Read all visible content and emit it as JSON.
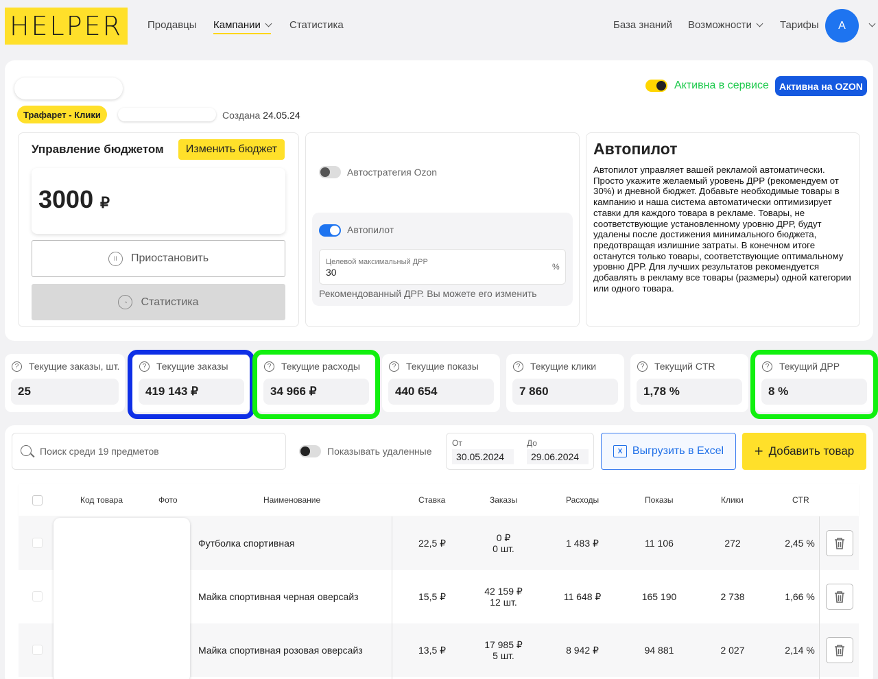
{
  "nav": {
    "logo": "HELPER",
    "links": [
      "Продавцы",
      "Кампании",
      "Статистика"
    ],
    "right_links": [
      "База знаний",
      "Возможности",
      "Тарифы"
    ],
    "avatar": "A"
  },
  "campaign": {
    "tag": "Трафарет - Клики",
    "created_label": "Создана",
    "created_date": "24.05.24",
    "status_active": "Активна в сервисе",
    "ozon_badge": "Активна на OZON"
  },
  "budget": {
    "title": "Управление бюджетом",
    "change_button": "Изменить бюджет",
    "amount": "3000",
    "currency": "₽",
    "pause_button": "Приостановить",
    "stats_button": "Статистика"
  },
  "strategy": {
    "autostrategy_label": "Автостратегия Ozon",
    "autopilot_label": "Автопилот",
    "drr_field_label": "Целевой максимальный ДРР",
    "drr_value": "30",
    "drr_unit": "%",
    "hint": "Рекомендованный ДРР. Вы можете его изменить"
  },
  "autopilot_info": {
    "title": "Автопилот",
    "text": "Автопилот управляет вашей рекламой автоматически. Просто укажите желаемый уровень ДРР (рекомендуем от 30%) и дневной бюджет. Добавьте необходимые товары в кампанию и наша система автоматически оптимизирует ставки для каждого товара в рекламе. Товары, не соответствующие установленному уровню ДРР, будут удалены после достижения минимального бюджета, предотвращая излишние затраты. В конечном итоге останутся только товары, соответствующие оптимальному уровню ДРР. Для лучших результатов рекомендуется добавлять в рекламу все товары (размеры) одной категории или одного товара."
  },
  "metrics": [
    {
      "label": "Текущие заказы, шт.",
      "value": "25"
    },
    {
      "label": "Текущие заказы",
      "value": "419 143 ₽"
    },
    {
      "label": "Текущие расходы",
      "value": "34 966 ₽"
    },
    {
      "label": "Текущие показы",
      "value": "440 654"
    },
    {
      "label": "Текущие клики",
      "value": "7 860"
    },
    {
      "label": "Текущий CTR",
      "value": "1,78 %"
    },
    {
      "label": "Текущий ДРР",
      "value": "8 %"
    }
  ],
  "toolbar": {
    "search_placeholder": "Поиск среди 19 предметов",
    "show_deleted": "Показывать удаленные",
    "from_label": "От",
    "from_date": "30.05.2024",
    "to_label": "До",
    "to_date": "29.06.2024",
    "excel_button": "Выгрузить в Excel",
    "add_button": "Добавить товар"
  },
  "table": {
    "headers": [
      "Код товара",
      "Фото",
      "Наименование",
      "Ставка",
      "Заказы",
      "Расходы",
      "Показы",
      "Клики",
      "CTR"
    ],
    "rows": [
      {
        "name": "Футболка спортивная",
        "bid": "22,5 ₽",
        "orders_sum": "0 ₽",
        "orders_qty": "0 шт.",
        "spend": "1 483 ₽",
        "views": "11 106",
        "clicks": "272",
        "ctr": "2,45 %"
      },
      {
        "name": "Майка спортивная черная оверсайз",
        "bid": "15,5 ₽",
        "orders_sum": "42 159 ₽",
        "orders_qty": "12 шт.",
        "spend": "11 648 ₽",
        "views": "165 190",
        "clicks": "2 738",
        "ctr": "1,66 %"
      },
      {
        "name": "Майка спортивная розовая оверсайз",
        "bid": "13,5 ₽",
        "orders_sum": "17 985 ₽",
        "orders_qty": "5 шт.",
        "spend": "8 942 ₽",
        "views": "94 881",
        "clicks": "2 027",
        "ctr": "2,14 %"
      }
    ]
  },
  "colors": {
    "brand_yellow": "#ffe02a",
    "active_green": "#1cc94b",
    "ozon_blue": "#1559e0",
    "highlight_blue": "#0e2fe6",
    "highlight_green": "#11f00f"
  }
}
